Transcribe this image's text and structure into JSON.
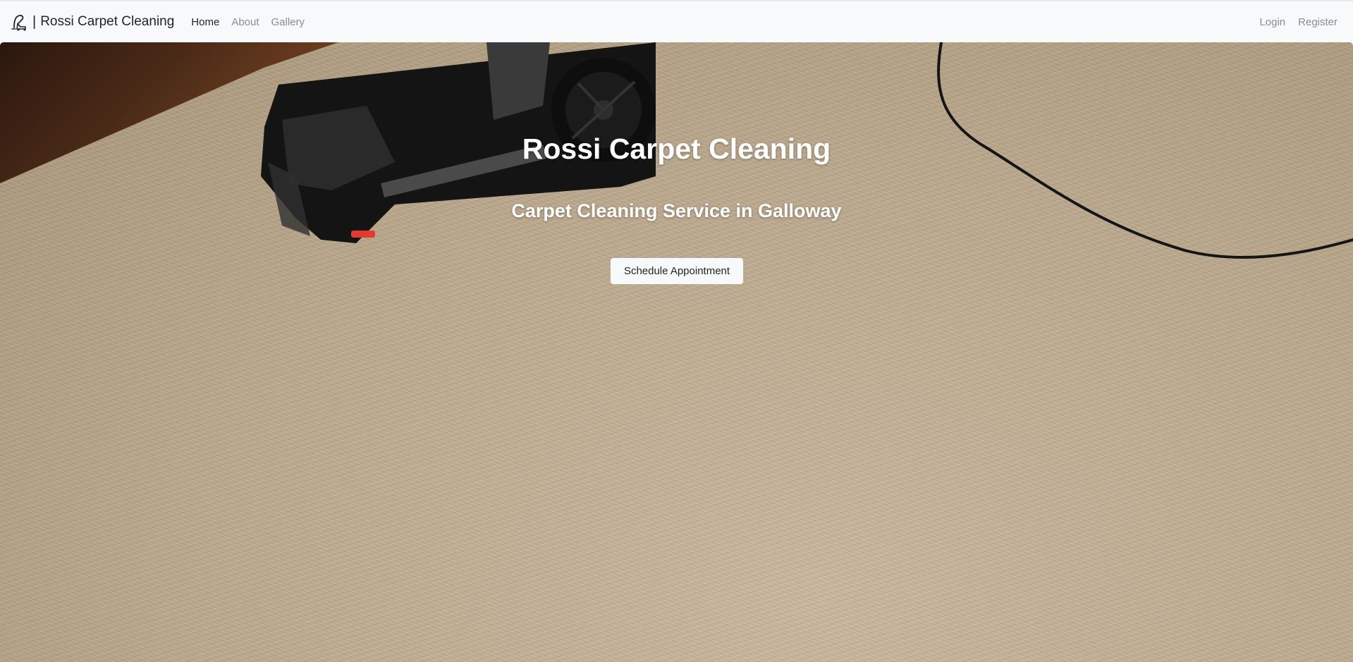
{
  "navbar": {
    "brand_icon": "vacuum-cleaner-icon",
    "brand_separator": "|",
    "brand_name": "Rossi Carpet Cleaning",
    "links": [
      {
        "label": "Home",
        "active": true
      },
      {
        "label": "About",
        "active": false
      },
      {
        "label": "Gallery",
        "active": false
      }
    ],
    "auth": {
      "login": "Login",
      "register": "Register"
    }
  },
  "hero": {
    "title": "Rossi Carpet Cleaning",
    "subtitle": "Carpet Cleaning Service in Galloway",
    "button_label": "Schedule Appointment"
  },
  "colors": {
    "navbar_bg": "#f8f9fa",
    "active_link": "#212529",
    "inactive_link": "#8a8d90",
    "hero_text": "#ffffff",
    "button_bg": "#f8f9fa"
  }
}
